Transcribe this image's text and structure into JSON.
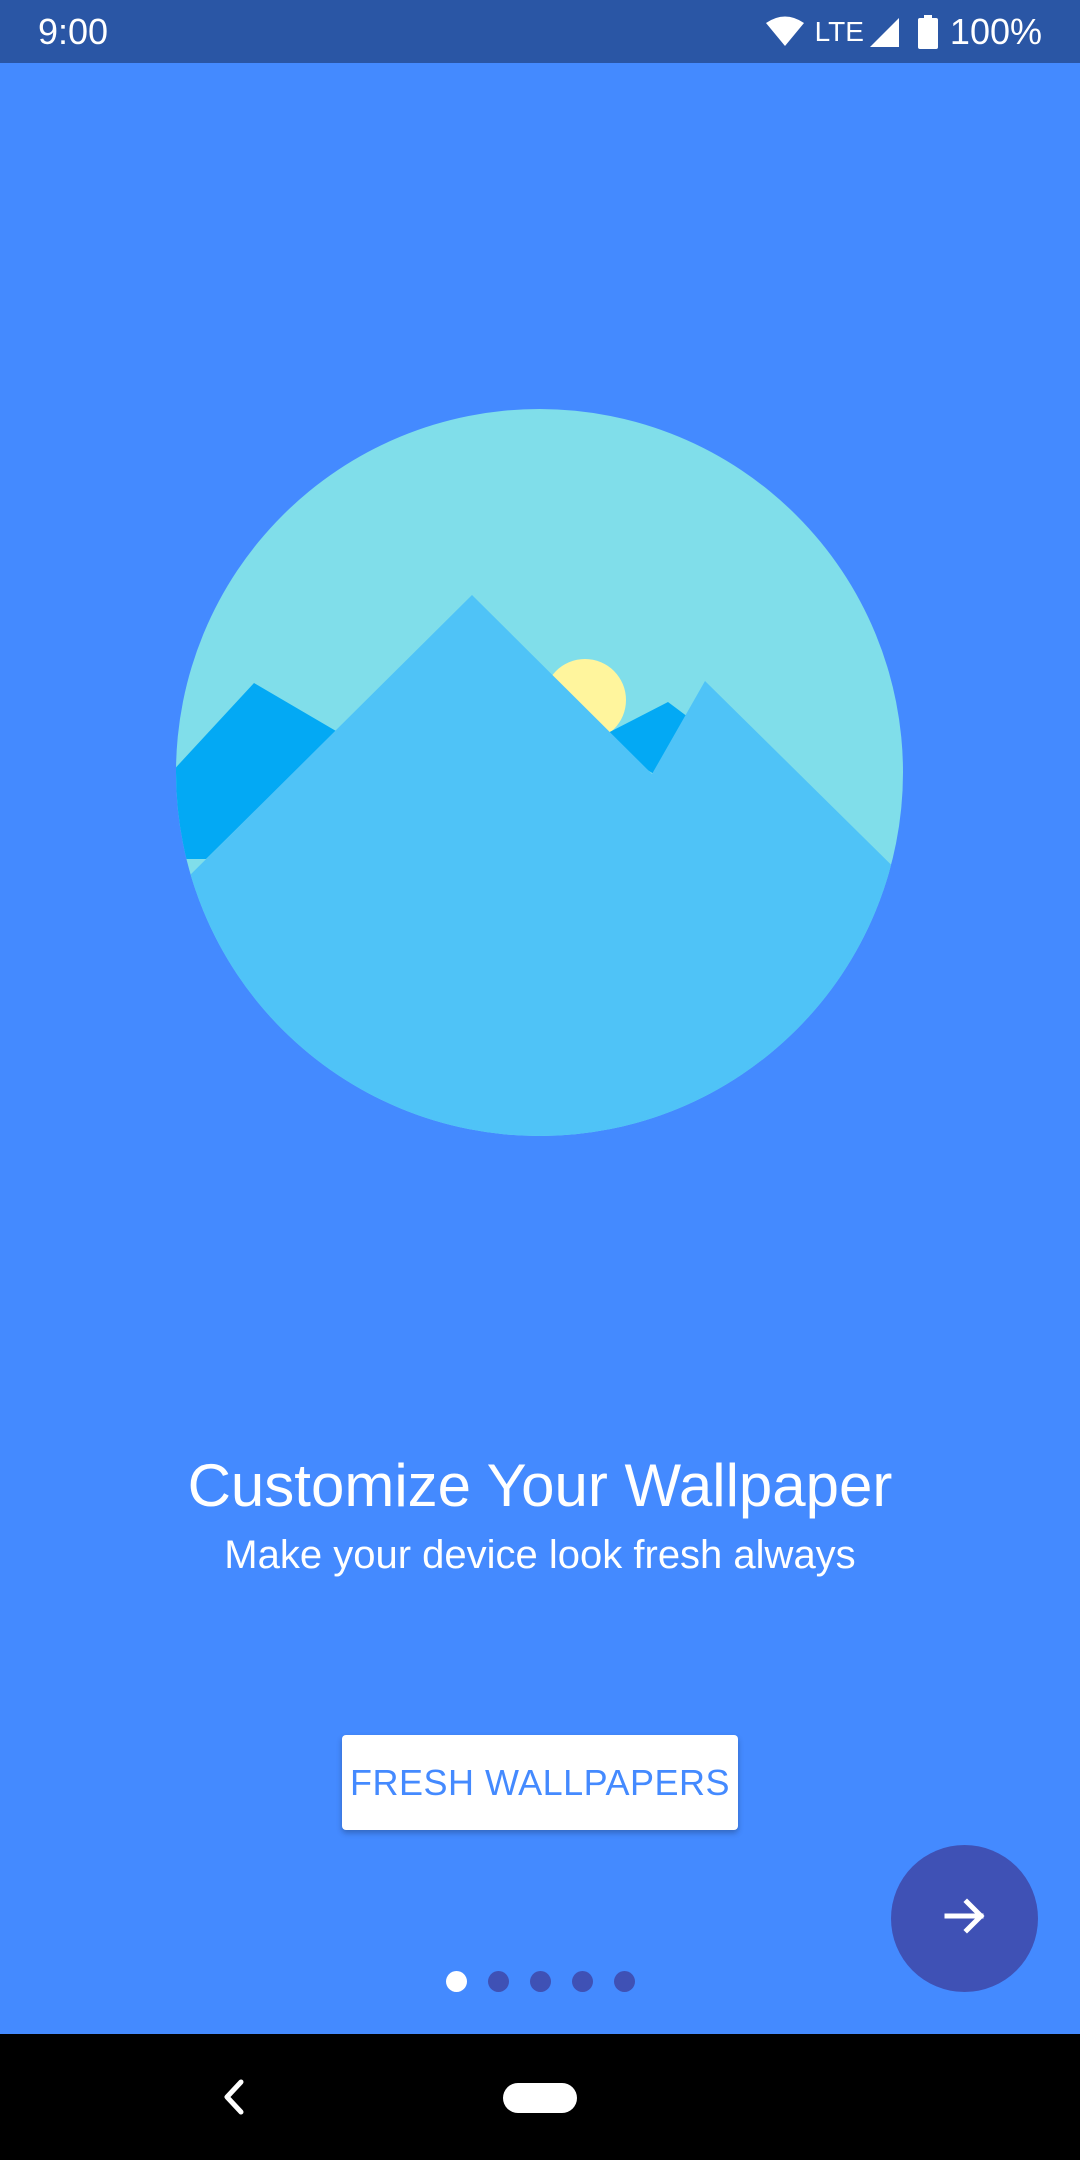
{
  "status_bar": {
    "time": "9:00",
    "network": "LTE",
    "battery": "100%",
    "icons": [
      "wifi-icon",
      "cell-signal-icon",
      "battery-icon"
    ]
  },
  "illustration": {
    "icon": "mountain-landscape-illustration",
    "colors": {
      "sky": "#80deea",
      "mountain_front": "#4fc3f7",
      "mountain_back": "#03a9f4",
      "sun": "#fff59d"
    }
  },
  "onboarding": {
    "title": "Customize Your Wallpaper",
    "subtitle": "Make your device look fresh always",
    "button_label": "FRESH WALLPAPERS",
    "next_icon": "arrow-right-icon",
    "page_count": 5,
    "current_page": 1
  },
  "colors": {
    "background": "#448aff",
    "status_bar": "#2a56a5",
    "fab": "#3f51b5",
    "dot_inactive": "#3f51b5",
    "dot_active": "#ffffff",
    "button_text": "#448aff"
  },
  "nav_bar": {
    "icons": [
      "back-icon",
      "home-pill-icon"
    ]
  }
}
